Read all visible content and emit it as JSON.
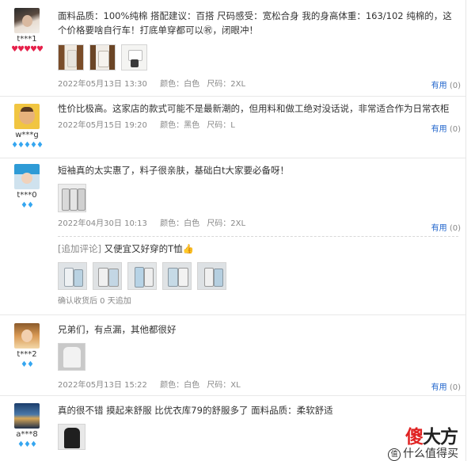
{
  "reviews": [
    {
      "user": "t***1",
      "badge_type": "heart",
      "badges": "♥♥♥♥♥",
      "text": "面料品质：100%纯棉 搭配建议：百搭 尺码感受：宽松合身 我的身高体重：163/102 纯棉的，这个价格要啥自行车！打底单穿都可以㊗，闭眼冲！",
      "date": "2022年05月13日 13:30",
      "color_label": "颜色：",
      "color_value": "白色",
      "size_label": "尺码：",
      "size_value": "2XL",
      "useful_label": "有用",
      "useful_count": "(0)"
    },
    {
      "user": "w***g",
      "badge_type": "diamond",
      "badges": "♦♦♦♦♦",
      "text": "性价比极高。这家店的款式可能不是最新潮的，但用料和做工绝对没话说，非常适合作为日常衣柜",
      "date": "2022年05月15日 19:20",
      "color_label": "颜色：",
      "color_value": "黑色",
      "size_label": "尺码：",
      "size_value": "L",
      "useful_label": "有用",
      "useful_count": "(0)"
    },
    {
      "user": "t***0",
      "badge_type": "diamond",
      "badges": "♦♦",
      "text": "短袖真的太实惠了，料子很亲肤，基础白t大家要必备呀！",
      "date": "2022年04月30日 10:13",
      "color_label": "颜色：",
      "color_value": "白色",
      "size_label": "尺码：",
      "size_value": "2XL",
      "useful_label": "有用",
      "useful_count": "(0)",
      "followup_tag": "[追加评论]",
      "followup_text": "又便宜又好穿的T恤👍",
      "followup_meta": "确认收货后 0 天追加"
    },
    {
      "user": "t***2",
      "badge_type": "diamond",
      "badges": "♦♦",
      "text": "兄弟们，有点漏，其他都很好",
      "date": "2022年05月13日 15:22",
      "color_label": "颜色：",
      "color_value": "白色",
      "size_label": "尺码：",
      "size_value": "XL",
      "useful_label": "有用",
      "useful_count": "(0)"
    },
    {
      "user": "a***8",
      "badge_type": "diamond",
      "badges": "♦♦♦",
      "text": "真的很不错 摸起来舒服 比优衣库79的舒服多了 面料品质：柔软舒适"
    }
  ],
  "watermark": {
    "brand_part1": "傻",
    "brand_part2": "大方",
    "small_mark": "值",
    "small_text": "什么值得买"
  }
}
